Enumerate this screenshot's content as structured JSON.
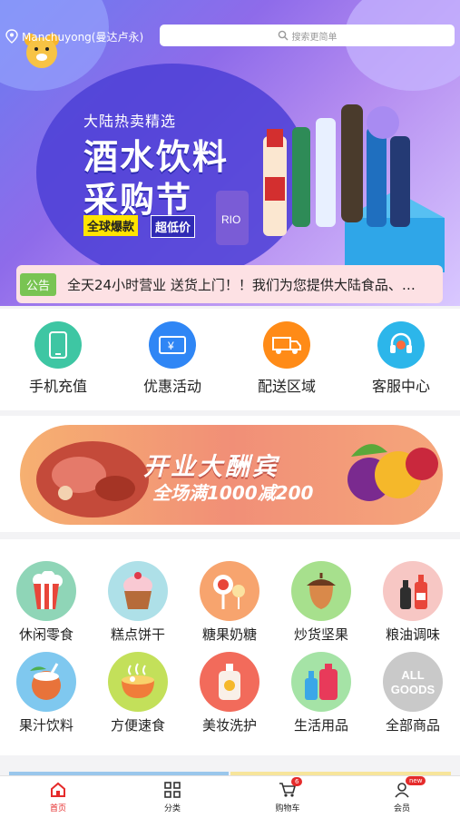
{
  "header": {
    "location": "Manchuyong(曼达卢永)",
    "search_placeholder": "搜索更简单"
  },
  "hero": {
    "title_small": "大陆热卖精选",
    "title_line1": "酒水饮料",
    "title_line2": "采购节",
    "tag_1": "全球爆款",
    "tag_2": "超低价"
  },
  "notice": {
    "label": "公告",
    "text": "全天24小时营业 送货上门！！我们为您提供大陆食品、…"
  },
  "quick_actions": [
    {
      "label": "手机充值",
      "color": "#3ec6a3",
      "icon": "phone-icon"
    },
    {
      "label": "优惠活动",
      "color": "#2f86f5",
      "icon": "ticket-icon"
    },
    {
      "label": "配送区域",
      "color": "#ff8b17",
      "icon": "truck-icon"
    },
    {
      "label": "客服中心",
      "color": "#2cb6ea",
      "icon": "headset-icon"
    }
  ],
  "promo": {
    "title": "开业大酬宾",
    "subtitle": "全场满1000减200"
  },
  "categories": [
    {
      "label": "休闲零食",
      "bg": "#8fd5b7",
      "icon": "popcorn-icon"
    },
    {
      "label": "糕点饼干",
      "bg": "#aee0e8",
      "icon": "cupcake-icon"
    },
    {
      "label": "糖果奶糖",
      "bg": "#f7a46e",
      "icon": "candy-icon"
    },
    {
      "label": "炒货坚果",
      "bg": "#a7e08d",
      "icon": "acorn-icon"
    },
    {
      "label": "粮油调味",
      "bg": "#f7c7c4",
      "icon": "bottles-icon"
    },
    {
      "label": "果汁饮料",
      "bg": "#7fc8ef",
      "icon": "coconut-icon"
    },
    {
      "label": "方便速食",
      "bg": "#c3e05a",
      "icon": "noodle-bowl-icon"
    },
    {
      "label": "美妆洗护",
      "bg": "#f26b5b",
      "icon": "lotion-icon"
    },
    {
      "label": "生活用品",
      "bg": "#a5e3a6",
      "icon": "detergent-icon"
    },
    {
      "label": "全部商品",
      "bg": "#c9c9c9",
      "icon": "all-goods-icon",
      "icon_text": "ALL GOODS"
    }
  ],
  "tabbar": [
    {
      "label": "首页",
      "active": true,
      "icon": "home-icon"
    },
    {
      "label": "分类",
      "icon": "grid-icon"
    },
    {
      "label": "购物车",
      "icon": "cart-icon",
      "badge": "6"
    },
    {
      "label": "会员",
      "icon": "user-icon",
      "badge": "new"
    }
  ],
  "colors": {
    "accent": "#e52b2b",
    "notice_label": "#79c453",
    "notice_bg": "#fde1e4"
  }
}
